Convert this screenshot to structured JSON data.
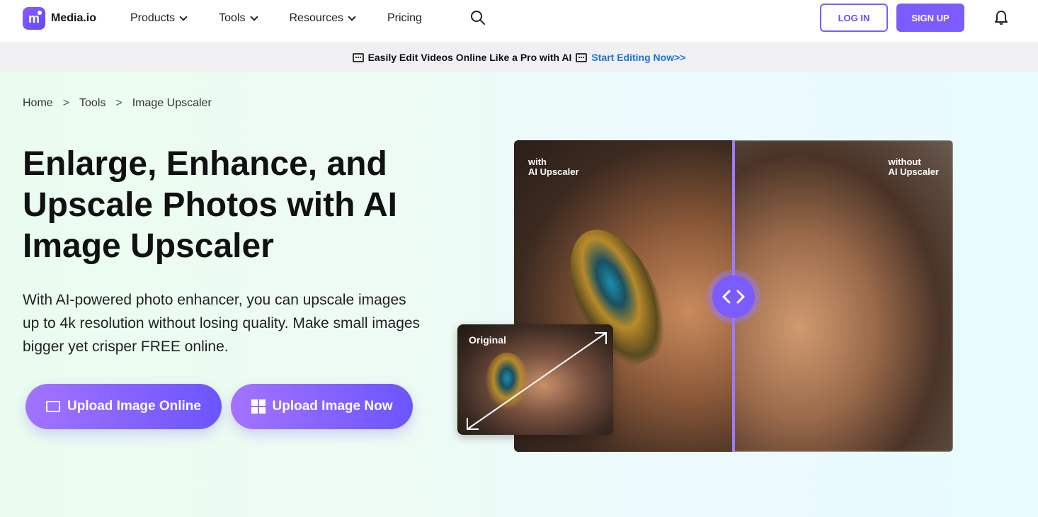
{
  "brand": {
    "name": "Media.io",
    "logo_letter": "m",
    "accent": "#7c5cff"
  },
  "nav": {
    "items": [
      {
        "label": "Products",
        "dropdown": true
      },
      {
        "label": "Tools",
        "dropdown": true
      },
      {
        "label": "Resources",
        "dropdown": true
      },
      {
        "label": "Pricing",
        "dropdown": false
      }
    ],
    "login_label": "LOG IN",
    "signup_label": "SIGN UP"
  },
  "promo": {
    "text": "Easily Edit Videos Online Like a Pro with AI",
    "link": "Start Editing Now>>"
  },
  "breadcrumb": [
    "Home",
    "Tools",
    "Image Upscaler"
  ],
  "hero": {
    "title": "Enlarge, Enhance, and Upscale Photos with AI Image Upscaler",
    "description": "With AI-powered photo enhancer, you can upscale images up to 4k resolution without losing quality. Make small images bigger yet crisper FREE online.",
    "upload_online_label": "Upload Image Online",
    "upload_now_label": "Upload Image Now"
  },
  "compare": {
    "with_line1": "with",
    "with_line2": "AI Upscaler",
    "without_line1": "without",
    "without_line2": "AI Upscaler",
    "original_label": "Original"
  }
}
